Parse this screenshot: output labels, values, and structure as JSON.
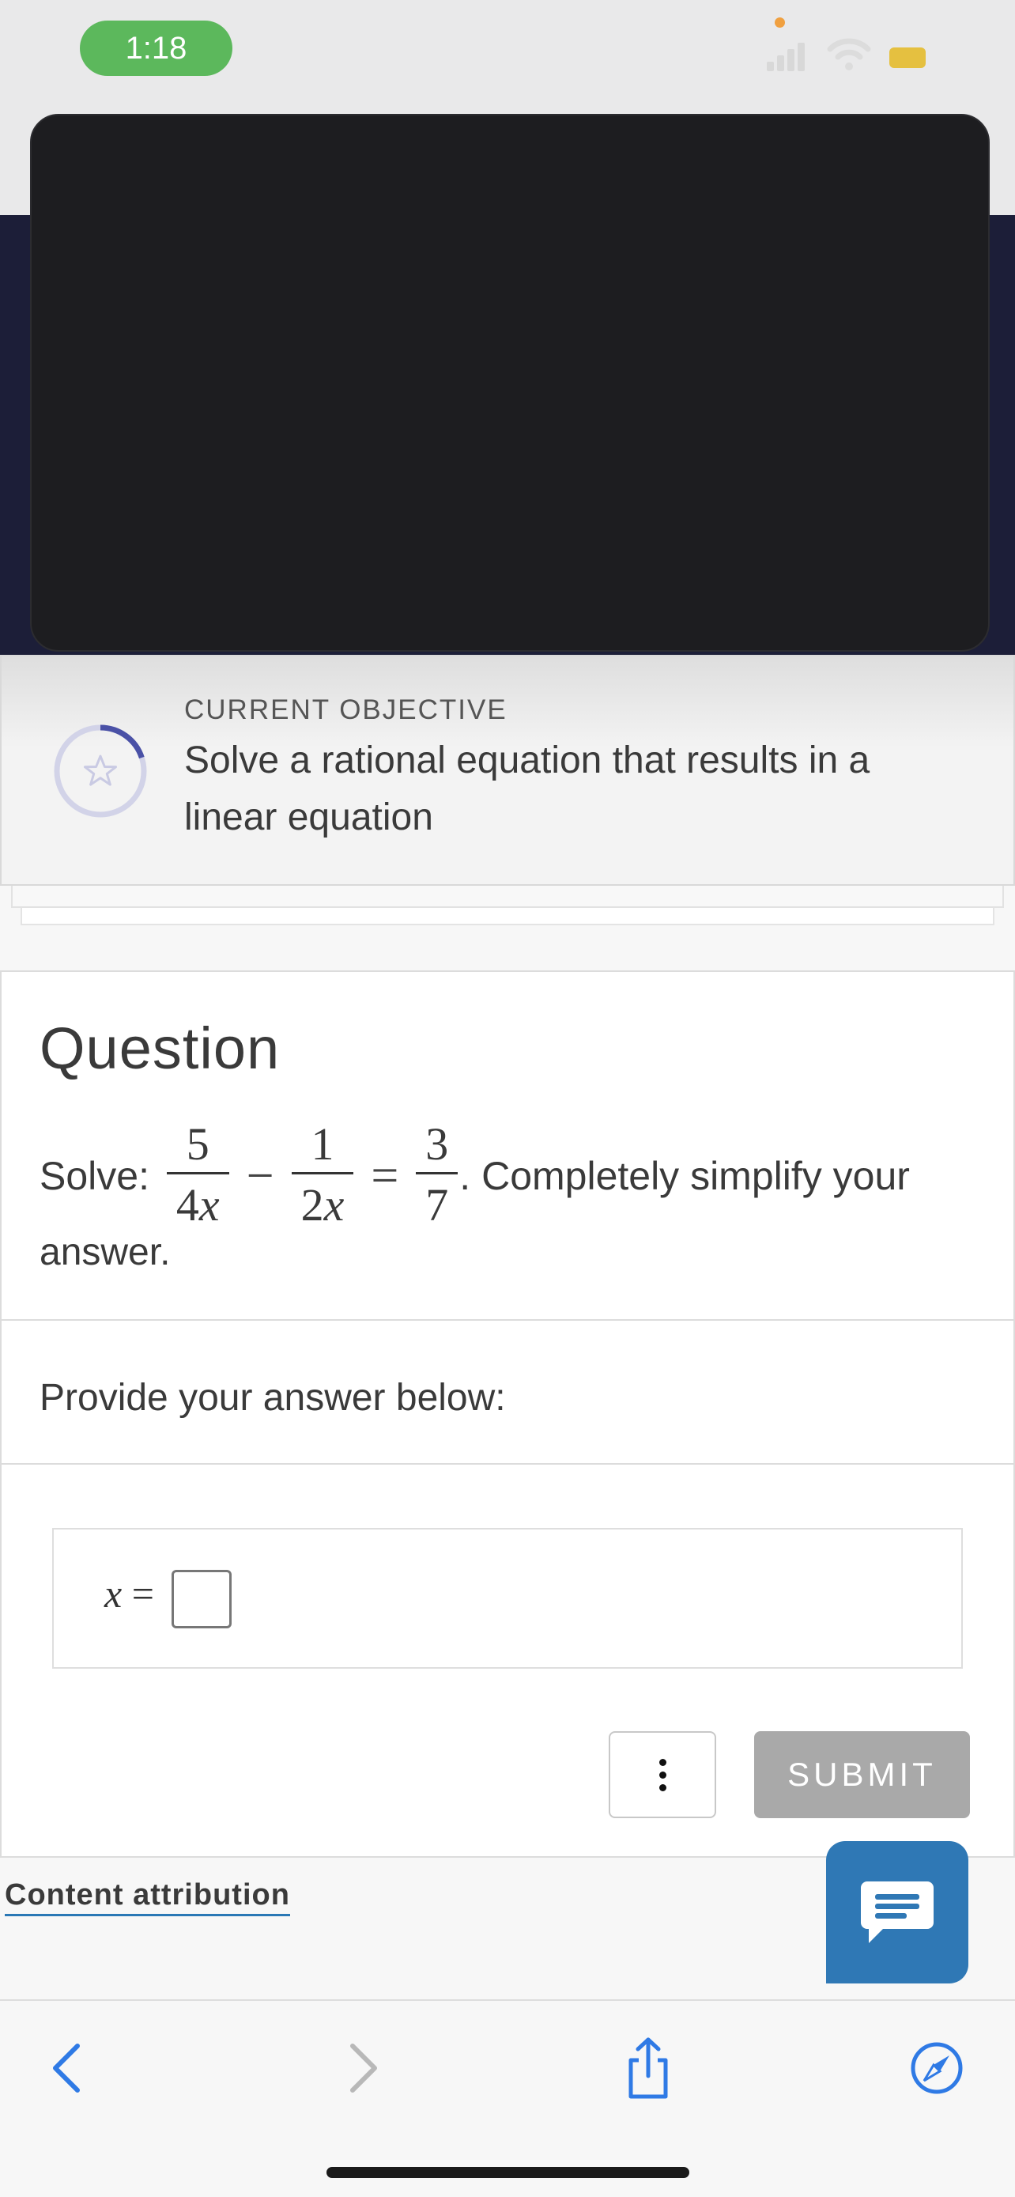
{
  "status_bar": {
    "time": "1:18"
  },
  "objective": {
    "caption": "CURRENT OBJECTIVE",
    "text": "Solve a rational equation that results in a linear equation",
    "progress_fraction": 0.2
  },
  "question": {
    "heading": "Question",
    "prefix": "Solve: ",
    "fractions": [
      {
        "num": "5",
        "den_coef": "4",
        "den_var": "x"
      },
      {
        "num": "1",
        "den_coef": "2",
        "den_var": "x"
      },
      {
        "num": "3",
        "den_coef": "7",
        "den_var": ""
      }
    ],
    "operators": [
      "−",
      "="
    ],
    "suffix": ". Completely simplify your",
    "suffix_line2": "answer."
  },
  "answer": {
    "prompt": "Provide your answer below:",
    "label_var": "x",
    "label_eq": " = ",
    "input_value": ""
  },
  "actions": {
    "submit_label": "SUBMIT"
  },
  "footer": {
    "attribution_label": "Content attribution"
  },
  "colors": {
    "accent": "#2f78b5",
    "status_pill": "#5cb85c",
    "submit_disabled": "#a9a9a9",
    "nav_dark": "#1c1e38"
  },
  "icons": {
    "back": "chevron-left-icon",
    "forward": "chevron-right-icon",
    "share": "share-icon",
    "compass": "compass-icon",
    "chat": "chat-icon",
    "star": "star-icon"
  }
}
